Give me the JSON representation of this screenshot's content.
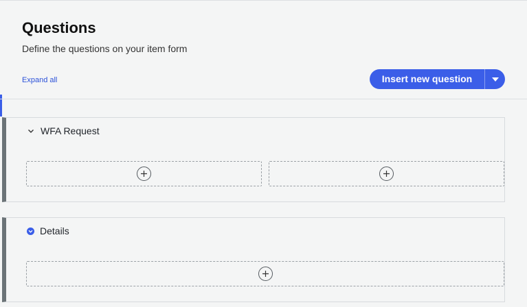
{
  "header": {
    "title": "Questions",
    "subtitle": "Define the questions on your item form",
    "expand_all": "Expand all",
    "insert_button_label": "Insert new question"
  },
  "sections": [
    {
      "title": "WFA Request",
      "expanded": true,
      "slot_count": 2
    },
    {
      "title": "Details",
      "expanded": true,
      "slot_count": 1
    }
  ],
  "colors": {
    "accent": "#3b5ee8",
    "section_bar": "#6b7377",
    "background": "#f4f5f5"
  },
  "icons": {
    "insert_dropdown": "caret-down-icon",
    "section1_toggle": "chevron-down-icon",
    "section2_toggle": "chevron-circle-down-icon",
    "slot_add": "plus-circle-icon"
  }
}
